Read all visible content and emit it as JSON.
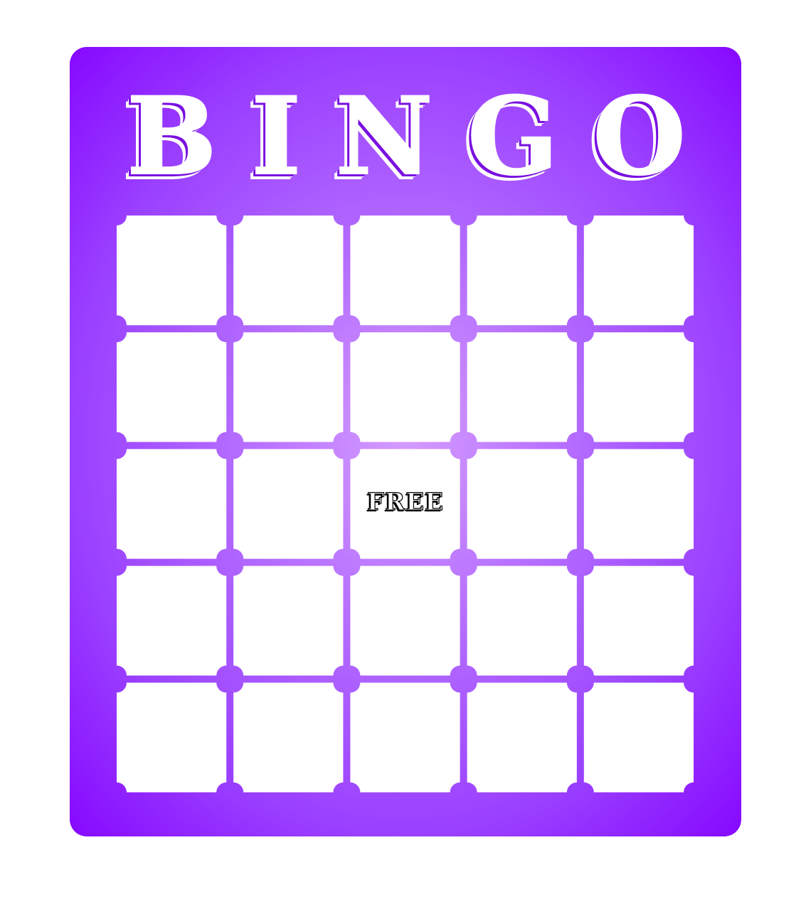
{
  "card": {
    "title_letters": [
      "B",
      "I",
      "N",
      "G",
      "O"
    ],
    "free_label": "FREE",
    "grid_rows": 5,
    "grid_columns": 5,
    "free_cell": {
      "row": 3,
      "column": 3
    }
  },
  "colors": {
    "card_edge": "#8608ff",
    "card_center": "#d49bff",
    "cell_fill": "#ffffff",
    "title_text": "#ffffff",
    "free_text_outline": "#000000"
  }
}
